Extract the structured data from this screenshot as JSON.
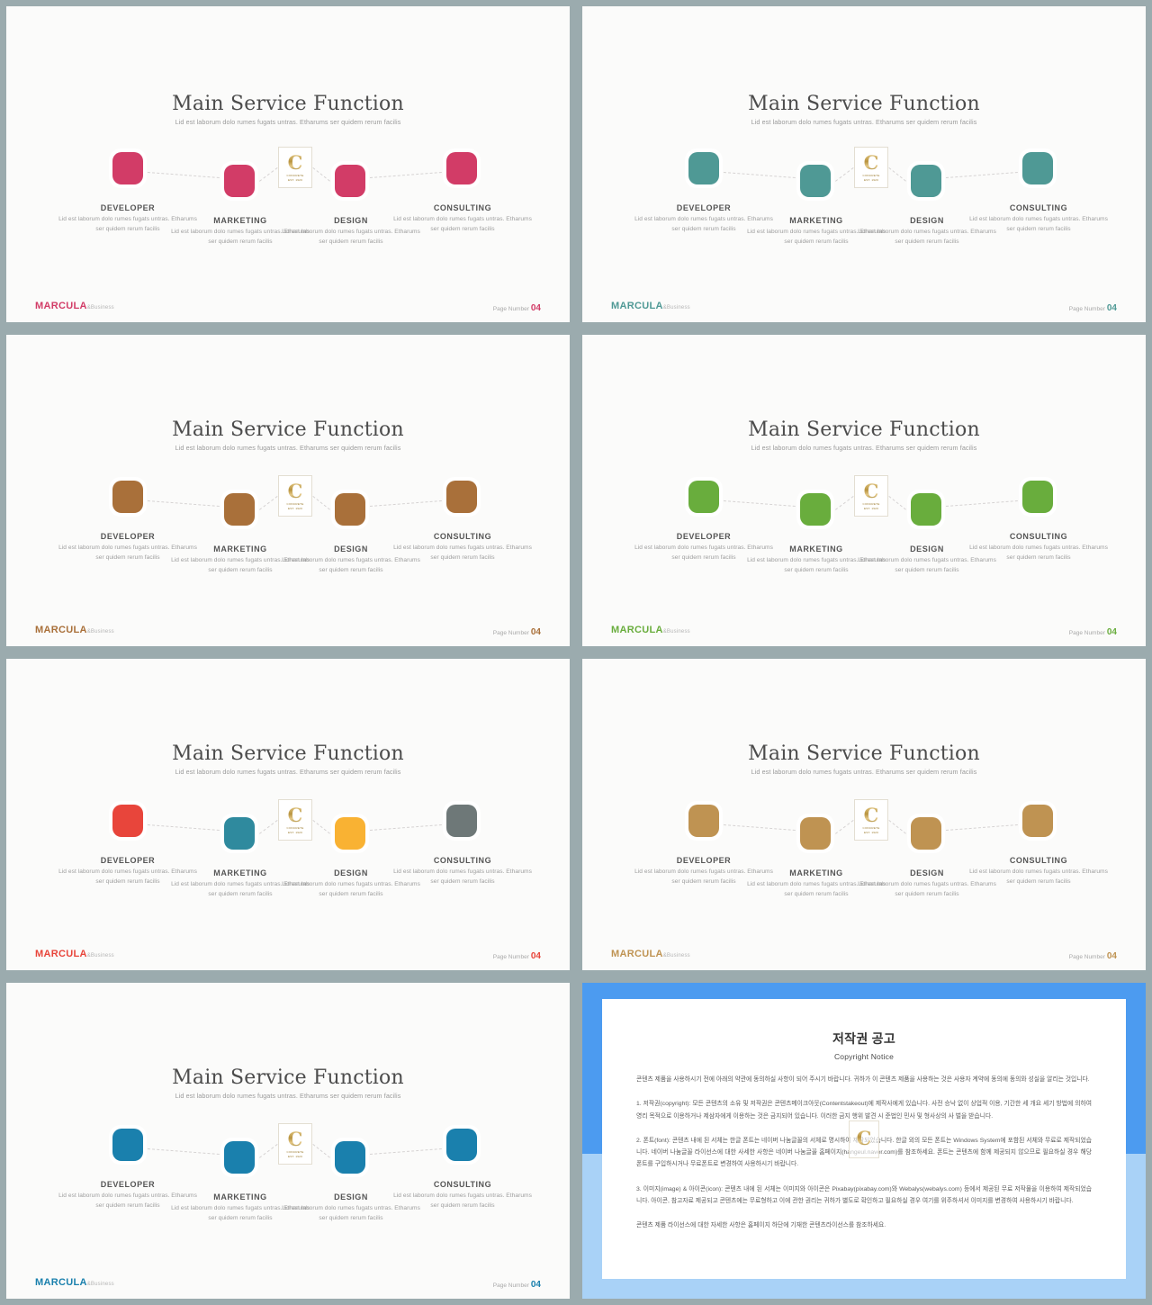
{
  "common": {
    "title": "Main Service Function",
    "subtitle": "Lid est laborum dolo rumes fugats untras. Etharums ser quidem rerum facilis",
    "brand_main": "MARCULA",
    "brand_sub": "&Business",
    "page_label": "Page Number",
    "page_number": "04",
    "logo_letter": "C",
    "logo_line1": "CONCRETE",
    "logo_line2": "EST. 1920",
    "body_text": "Lid est laborum dolo rumes fugats untras. Etharums ser quidem rerum facilis",
    "steps": [
      "DEVELOPER",
      "MARKETING",
      "DESIGN",
      "CONSULTING"
    ]
  },
  "slides": [
    {
      "id": "slide-1-pink",
      "accent": "#d23c67",
      "brand_color": "#d23c67",
      "node_colors": [
        "#d23c67",
        "#d23c67",
        "#d23c67",
        "#d23c67"
      ]
    },
    {
      "id": "slide-2-teal",
      "accent": "#4f9995",
      "brand_color": "#4f9995",
      "node_colors": [
        "#4f9995",
        "#4f9995",
        "#4f9995",
        "#4f9995"
      ]
    },
    {
      "id": "slide-3-brown",
      "accent": "#a9703a",
      "brand_color": "#a9703a",
      "node_colors": [
        "#a9703a",
        "#a9703a",
        "#a9703a",
        "#a9703a"
      ]
    },
    {
      "id": "slide-4-green",
      "accent": "#69ad3d",
      "brand_color": "#69ad3d",
      "node_colors": [
        "#69ad3d",
        "#69ad3d",
        "#69ad3d",
        "#69ad3d"
      ]
    },
    {
      "id": "slide-5-multicolor",
      "accent": "#e8453b",
      "brand_color": "#e8453b",
      "node_colors": [
        "#e8453b",
        "#2f8a9e",
        "#f9b233",
        "#6e7878"
      ]
    },
    {
      "id": "slide-6-bronze",
      "accent": "#bf9352",
      "brand_color": "#bf9352",
      "node_colors": [
        "#bf9352",
        "#bf9352",
        "#bf9352",
        "#bf9352"
      ]
    },
    {
      "id": "slide-7-blue",
      "accent": "#1a80ad",
      "brand_color": "#1a80ad",
      "node_colors": [
        "#1a80ad",
        "#1a80ad",
        "#1a80ad",
        "#1a80ad"
      ]
    }
  ],
  "copyright": {
    "heading_ko": "저작권 공고",
    "heading_en": "Copyright Notice",
    "intro": "콘텐츠 제품을 사용하시기 전에 아래의 약관에 동의하실 사항이 되어 주시기 바랍니다. 귀하가 이 콘텐츠 제품을 사용하는 것은 사용자 계약에 동의에 동의와 성실을 알리는 것입니다.",
    "p1": "1. 저작권(copyright): 모든 콘텐츠의 소유 및 저작권은 콘텐츠메이크아웃(Contentstakeout)에 제작사에게 있습니다. 사전 승낙 없이 상업적 이용, 기간한 세 개요 세기 방법에 의하여 영리 목적으로 이용하거나 제삼자에게 이용하는 것은 금지되어 있습니다. 이러한 금지 행위 발견 시 준법인 민사 및 형사상의 사 벌을 받습니다.",
    "p2": "2. 폰트(font): 콘텐츠 내에 된 서체는 한글 폰트는 네이버 나눔글꼴의 서체로 명시하여 제작되었습니다. 한글 외의 모든 폰트는 Windows System에 포함된 서체와 무료로 제작되었습니다. 네이버 나눔글꼴 라이선스에 대한 사세한 사항은 네이버 나눔글꼴 홈페이지(hangeul.naver.com)를 참조하세요. 폰트는 콘텐츠에 함께 제공되지 않으므로 필요하실 경우 해당 폰트를 구입하시거나 무료폰트로 변경하여 사용하시기 바랍니다.",
    "p3": "3. 이미지(image) & 아이콘(icon): 콘텐츠 내에 된 서체는 이미지와 아이콘은 Pixabay(pixabay.com)와 Webalys(webalys.com) 등에서 제공된 무료 저작물을 이용하여 제작되었습니다. 아이콘, 참고자료 제공되고 콘텐츠에는 무료형하고 이에 관한 권리는 귀하가 별도로 확인하고 필요하실 경우 여기를 위주하셔서 이미지를 변경하여 사용하시기 바랍니다.",
    "p4": "콘텐츠 제품 라이선스에 대한 자세한 사항은 홈페이지 하단에 기재한 콘텐츠라이선스를 참조하세요.",
    "logo_letter": "C"
  }
}
